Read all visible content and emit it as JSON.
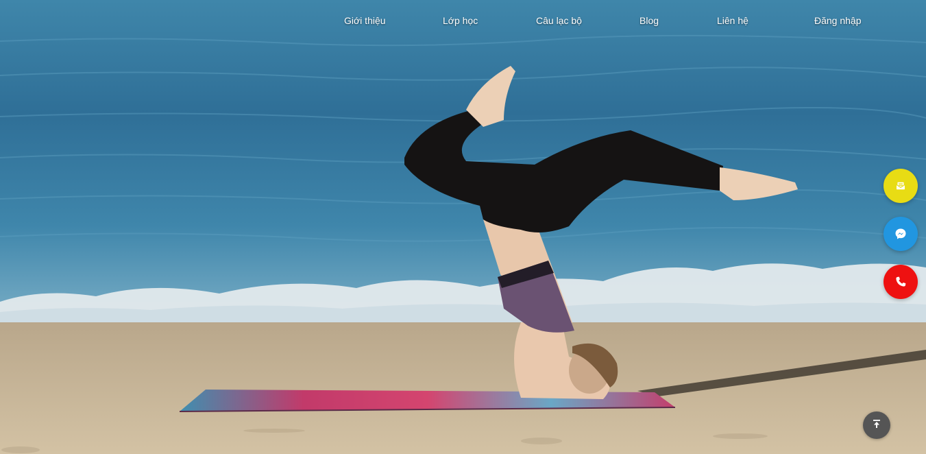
{
  "nav": {
    "items": [
      {
        "label": "Giới thiệu"
      },
      {
        "label": "Lớp học"
      },
      {
        "label": "Câu lạc bộ"
      },
      {
        "label": "Blog"
      },
      {
        "label": "Liên hệ"
      },
      {
        "label": "Đăng nhập"
      }
    ]
  },
  "floating_contacts": [
    {
      "icon": "mail-icon",
      "color": "#e8dc14"
    },
    {
      "icon": "messenger-icon",
      "color": "#2196e0"
    },
    {
      "icon": "phone-icon",
      "color": "#ee1111"
    }
  ],
  "back_to_top": {
    "icon": "arrow-up-to-line-icon",
    "color": "#555555"
  },
  "hero": {
    "scene": "yoga-headstand-beach"
  }
}
